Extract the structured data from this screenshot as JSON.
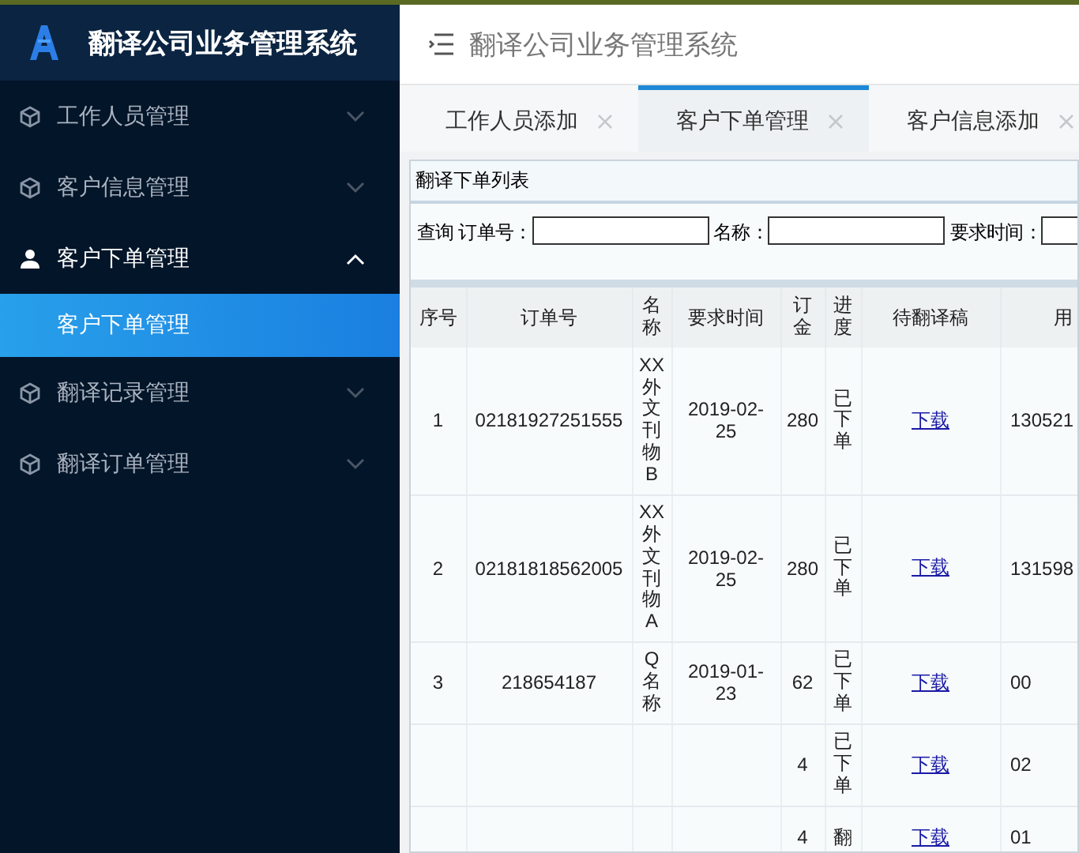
{
  "sidebar": {
    "title": "翻译公司业务管理系统",
    "menu": [
      {
        "label": "工作人员管理",
        "kind": "cube",
        "expanded": false
      },
      {
        "label": "客户信息管理",
        "kind": "cube",
        "expanded": false
      },
      {
        "label": "客户下单管理",
        "kind": "person",
        "expanded": true,
        "children": [
          {
            "label": "客户下单管理",
            "selected": true
          }
        ]
      },
      {
        "label": "翻译记录管理",
        "kind": "cube",
        "expanded": false
      },
      {
        "label": "翻译订单管理",
        "kind": "cube",
        "expanded": false
      }
    ]
  },
  "header": {
    "title": "翻译公司业务管理系统"
  },
  "tabs": [
    {
      "label": "工作人员添加",
      "selected": false
    },
    {
      "label": "客户下单管理",
      "selected": true
    },
    {
      "label": "客户信息添加",
      "selected": false
    }
  ],
  "panel": {
    "title": "翻译下单列表",
    "query_label": "查询",
    "filters": [
      {
        "label": "订单号："
      },
      {
        "label": "名称："
      },
      {
        "label": "要求时间："
      }
    ]
  },
  "table": {
    "columns": [
      "序号",
      "订单号",
      "名称",
      "要求时间",
      "订金",
      "进度",
      "待翻译稿",
      "用"
    ],
    "rows": [
      {
        "cells": [
          "1",
          "02181927251555",
          "XX外文刊物B",
          "2019-02-25",
          "280",
          "已下单",
          "下载",
          "130521"
        ]
      },
      {
        "cells": [
          "2",
          "02181818562005",
          "XX外文刊物A",
          "2019-02-25",
          "280",
          "已下单",
          "下载",
          "131598"
        ]
      },
      {
        "cells": [
          "3",
          "218654187",
          "Q名称",
          "2019-01-23",
          "62",
          "已下单",
          "下载",
          "00"
        ]
      },
      {
        "cells": [
          "",
          "",
          "",
          "",
          "4",
          "已下单",
          "下载",
          "02"
        ]
      },
      {
        "cells": [
          "",
          "",
          "",
          "",
          "4",
          "翻",
          "下载",
          "01"
        ]
      }
    ]
  }
}
